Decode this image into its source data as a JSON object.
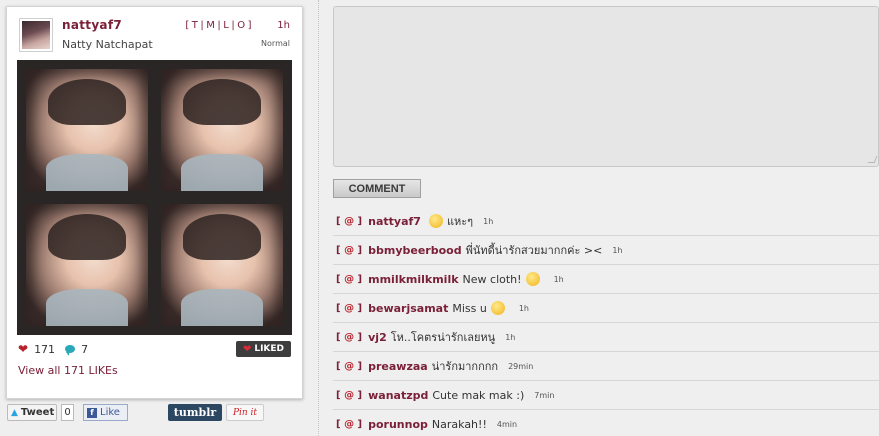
{
  "post": {
    "username": "nattyaf7",
    "fullname": "Natty Natchapat",
    "tmlo": "[T|M|L|O]",
    "time": "1h",
    "filter": "Normal",
    "likes": "171",
    "comments": "7",
    "liked_label": "LIKED",
    "view_all": "View all 171 LIKEs"
  },
  "share": {
    "tweet_label": "Tweet",
    "tweet_count": "0",
    "like_label": "Like",
    "tumblr_label": "tumblr",
    "pinit_label": "Pin it"
  },
  "form": {
    "comment_value": "",
    "comment_button": "COMMENT"
  },
  "comments": [
    {
      "at": "@",
      "user": "nattyaf7",
      "text": "แหะๆ",
      "emoji": "grin-emoji",
      "time": "1h"
    },
    {
      "at": "@",
      "user": "bbmybeerbood",
      "text": "พี่นัทดี้น่ารักสวยมากกค่ะ ><",
      "emoji": "",
      "time": "1h"
    },
    {
      "at": "@",
      "user": "mmilkmilkmilk",
      "text": "New cloth!",
      "emoji": "smile-emoji",
      "time": "1h"
    },
    {
      "at": "@",
      "user": "bewarjsamat",
      "text": "Miss u",
      "emoji": "kiss-emoji",
      "time": "1h"
    },
    {
      "at": "@",
      "user": "vj2",
      "text": "โห..โคตรน่ารักเลยหนู",
      "emoji": "",
      "time": "1h"
    },
    {
      "at": "@",
      "user": "preawzaa",
      "text": "น่ารักมากกกก",
      "emoji": "",
      "time": "29min"
    },
    {
      "at": "@",
      "user": "wanatzpd",
      "text": "Cute mak mak :)",
      "emoji": "",
      "time": "7min"
    },
    {
      "at": "@",
      "user": "porunnop",
      "text": "Narakah!!",
      "emoji": "",
      "time": "4min"
    }
  ]
}
